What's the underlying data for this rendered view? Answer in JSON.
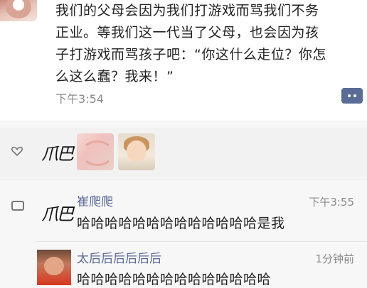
{
  "post": {
    "lines": [
      "我们的父母会因为我们打游戏而骂我们不务",
      "正业。等我们这一代当了父母，也会因为孩",
      "子打游戏而骂孩子吧：“你这什么走位？你怎",
      "么这么蠢？我来！”"
    ],
    "time": "下午3:54"
  },
  "likes": {
    "name": "爪巴",
    "icon": "heart-outline-icon"
  },
  "comments": [
    {
      "avatar_text": "爪巴",
      "name": "崔爬爬",
      "time": "下午3:55",
      "text": "哈哈哈哈哈哈哈哈哈哈哈哈哈是我"
    },
    {
      "name": "太后后后后后后",
      "time": "1分钟前",
      "text": "哈哈哈哈哈哈哈哈哈哈哈哈哈哈"
    }
  ],
  "icons": {
    "comment_button": "comment-ellipsis-icon",
    "comment_section": "speech-bubble-icon"
  },
  "colors": {
    "link_name": "#5a6b95",
    "timestamp": "#8a8a8a",
    "comment_button_bg": "#5a6b95"
  }
}
